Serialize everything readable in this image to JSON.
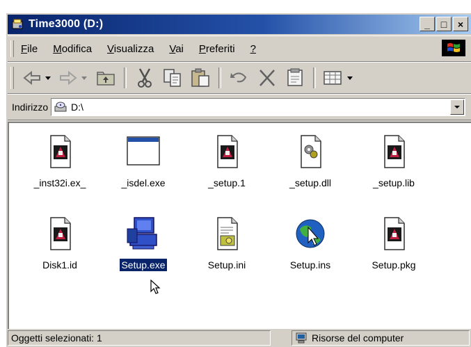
{
  "window": {
    "title": "Time3000 (D:)",
    "buttons": {
      "minimize": "_",
      "maximize": "□",
      "close": "×"
    }
  },
  "menubar": {
    "items": [
      {
        "label": "File",
        "u": "F",
        "rest": "ile"
      },
      {
        "label": "Modifica",
        "u": "M",
        "rest": "odifica"
      },
      {
        "label": "Visualizza",
        "u": "V",
        "rest": "isualizza"
      },
      {
        "label": "Vai",
        "u": "V",
        "rest": "ai"
      },
      {
        "label": "Preferiti",
        "u": "P",
        "rest": "referiti"
      },
      {
        "label": "?",
        "u": "?",
        "rest": ""
      }
    ]
  },
  "toolbar": {
    "buttons": [
      "back-icon",
      "forward-icon",
      "up-folder-icon",
      "cut-icon",
      "copy-icon",
      "paste-icon",
      "undo-icon",
      "delete-icon",
      "properties-icon",
      "views-icon"
    ]
  },
  "address": {
    "label": "Indirizzo",
    "path": "D:\\"
  },
  "files": [
    {
      "name": "_inst32i.ex_",
      "icon": "setup-doc-icon"
    },
    {
      "name": "_isdel.exe",
      "icon": "window-app-icon"
    },
    {
      "name": "_setup.1",
      "icon": "setup-doc-icon"
    },
    {
      "name": "_setup.dll",
      "icon": "dll-icon"
    },
    {
      "name": "_setup.lib",
      "icon": "setup-doc-icon"
    },
    {
      "name": "Disk1.id",
      "icon": "setup-doc-icon"
    },
    {
      "name": "Setup.exe",
      "icon": "installer-computer-icon",
      "selected": true
    },
    {
      "name": "Setup.ini",
      "icon": "ini-settings-icon"
    },
    {
      "name": "Setup.ins",
      "icon": "globe-script-icon"
    },
    {
      "name": "Setup.pkg",
      "icon": "setup-doc-icon"
    }
  ],
  "statusbar": {
    "selected": "Oggetti selezionati: 1",
    "location": "Risorse del computer"
  },
  "colors": {
    "titlebar_start": "#08246b",
    "titlebar_end": "#a6caf0",
    "selection": "#0a246a",
    "face": "#d4d0c8"
  }
}
